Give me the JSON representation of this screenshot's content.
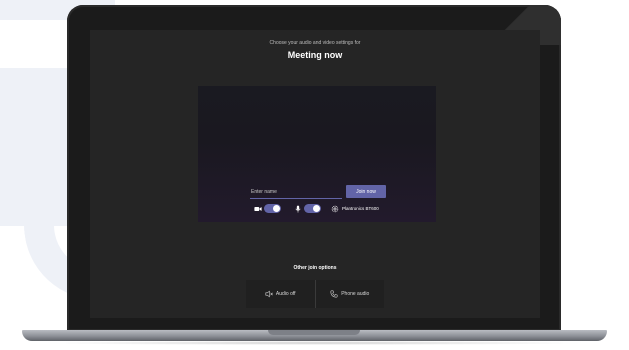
{
  "prejoin": {
    "subtitle": "Choose your audio and video settings for",
    "meeting_title": "Meeting now"
  },
  "preview": {
    "name_placeholder": "Enter name",
    "join_label": "Join now",
    "camera_on": true,
    "mic_on": true,
    "device_label": "Plantronics BT600"
  },
  "other_options": {
    "title": "Other join options",
    "items": [
      {
        "label": "Audio off",
        "icon": "speaker-off-icon"
      },
      {
        "label": "Phone audio",
        "icon": "phone-icon"
      }
    ]
  },
  "colors": {
    "accent": "#6264a7",
    "screen_bg": "#252525",
    "preview_bg": "#1a1820",
    "lid": "#1b1b1b"
  }
}
